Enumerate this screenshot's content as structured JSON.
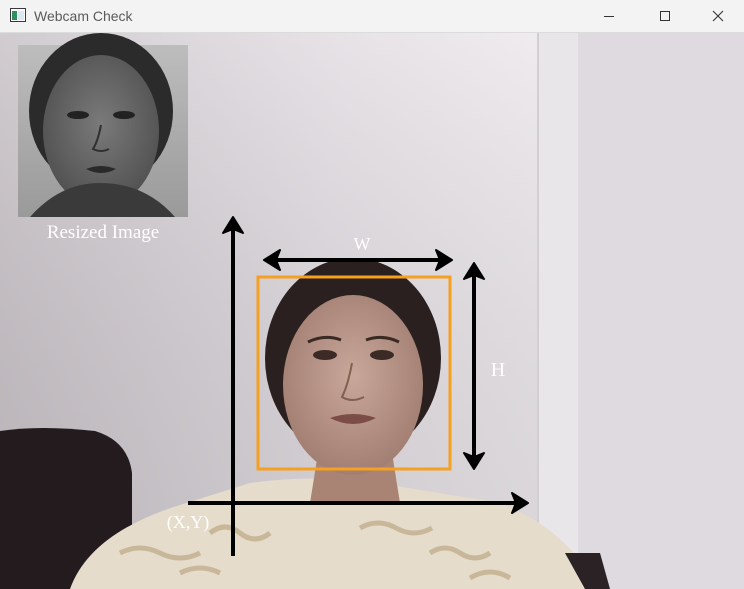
{
  "window": {
    "title": "Webcam Check",
    "controls": {
      "minimize_icon": "minimize-icon",
      "maximize_icon": "maximize-icon",
      "close_icon": "close-icon"
    }
  },
  "video": {
    "thumbnail_caption": "Resized Image",
    "width_label": "W",
    "height_label": "H",
    "origin_label": "(X,Y)",
    "colors": {
      "detection_box": "#f5a020",
      "arrows": "#000000",
      "labels": "#ffffff"
    }
  }
}
